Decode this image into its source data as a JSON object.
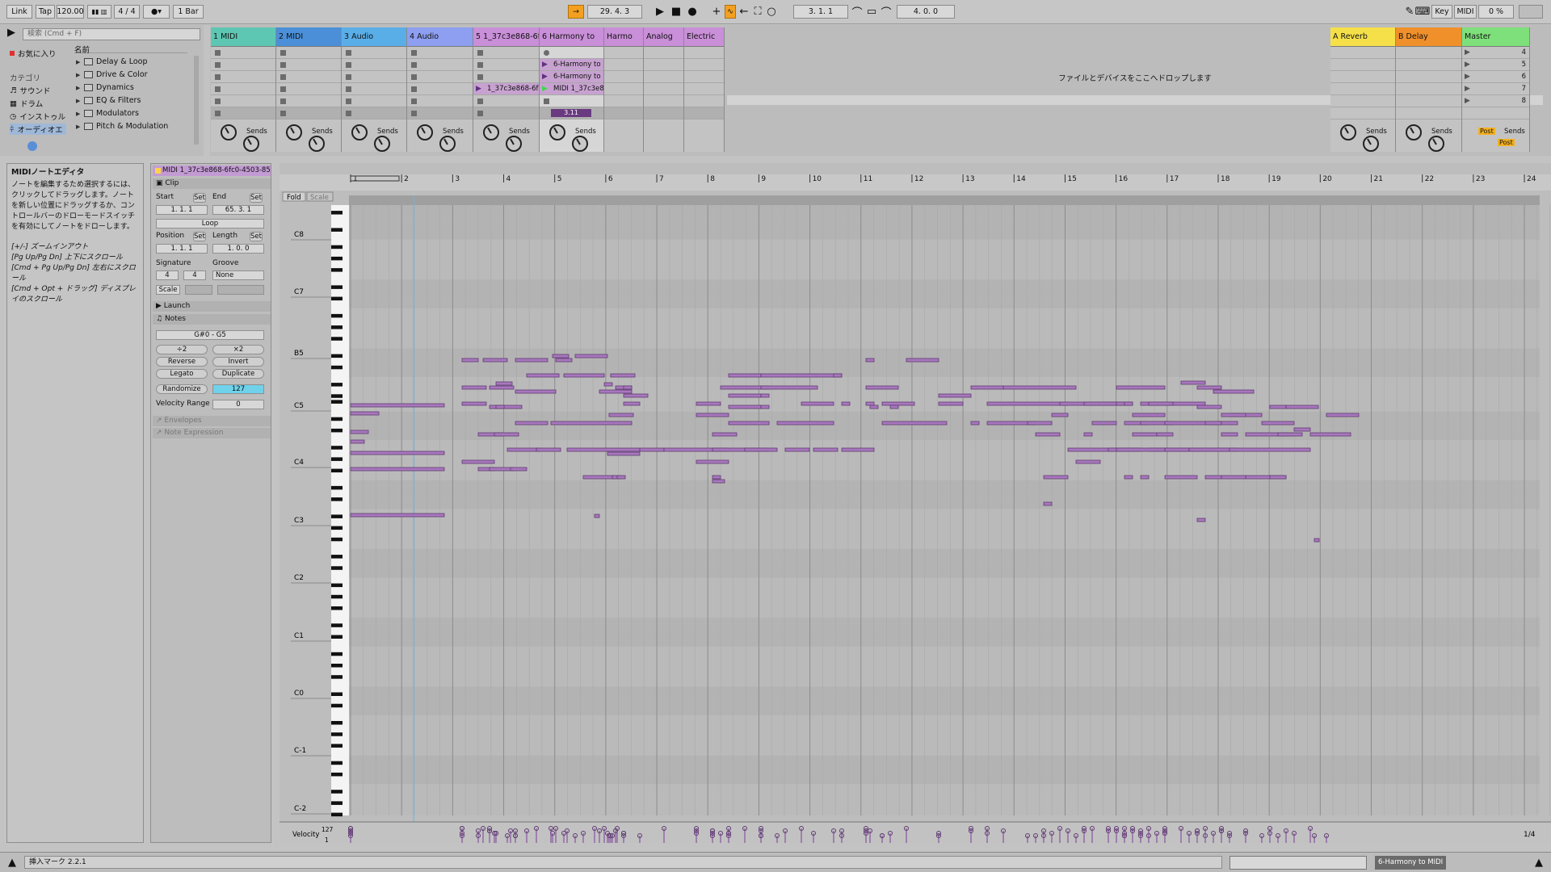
{
  "transport": {
    "link": "Link",
    "tap": "Tap",
    "tempo": "120.00",
    "signature": "4 / 4",
    "quantize": "1 Bar",
    "position": "29.   4.   3",
    "loop_start": "3.   1.   1",
    "loop_length": "4.   0.   0",
    "key": "Key",
    "midi": "MIDI",
    "cpu": "0 %"
  },
  "browser": {
    "search_placeholder": "検索 (Cmd + F)",
    "favorites": "お気に入り",
    "category_title": "カテゴリ",
    "categories": [
      "サウンド",
      "ドラム",
      "インストゥル",
      "オーディオエ"
    ],
    "name_header": "名前",
    "folders": [
      "Delay & Loop",
      "Drive & Color",
      "Dynamics",
      "EQ & Filters",
      "Modulators",
      "Pitch & Modulation"
    ]
  },
  "tracks": [
    {
      "name": "1 MIDI",
      "color": "#5ec7b3"
    },
    {
      "name": "2 MIDI",
      "color": "#4a8fd8"
    },
    {
      "name": "3 Audio",
      "color": "#5aaee8"
    },
    {
      "name": "4 Audio",
      "color": "#8e9ef0"
    },
    {
      "name": "5 1_37c3e868-6fc",
      "color": "#c98fd8"
    },
    {
      "name": "6 Harmony to",
      "color": "#c98fd8"
    },
    {
      "name": "Harmo",
      "color": "#c98fd8"
    },
    {
      "name": "Analog",
      "color": "#c98fd8"
    },
    {
      "name": "Electric",
      "color": "#c98fd8"
    }
  ],
  "clips": {
    "track5_clip": "1_37c3e868-6f",
    "track6_clip1": "6-Harmony to M",
    "track6_clip2": "6-Harmony to M",
    "track6_clip3": "MIDI 1_37c3e8",
    "track6_playhead": "3.11"
  },
  "returns": [
    {
      "name": "A Reverb",
      "color": "#f5e04a"
    },
    {
      "name": "B Delay",
      "color": "#f0902a"
    },
    {
      "name": "Master",
      "color": "#7ee07a"
    }
  ],
  "scene_numbers": [
    "4",
    "5",
    "6",
    "7",
    "8"
  ],
  "drop_hint": "ファイルとデバイスをここへドロップします",
  "sends_label": "Sends",
  "post_label": "Post",
  "info_view": {
    "title": "MIDIノートエディタ",
    "body": "ノートを編集するため選択するには、クリックしてドラッグします。ノートを新しい位置にドラッグするか、コントロールバーのドローモードスイッチを有効にしてノートをドローします。",
    "shortcut1": "[+/-] ズームインアウト",
    "shortcut2": "[Pg Up/Pg Dn] 上下にスクロール",
    "shortcut3": "[Cmd + Pg Up/Pg Dn] 左右にスクロール",
    "shortcut4": "[Cmd + Opt + ドラッグ] ディスプレイのスクロール"
  },
  "clip_view": {
    "title": "MIDI 1_37c3e868-6fc0-4503-85",
    "clip_label": "Clip",
    "start_label": "Start",
    "end_label": "End",
    "set": "Set",
    "start_value": "1.   1.   1",
    "end_value": "65.   3.   1",
    "loop": "Loop",
    "position_label": "Position",
    "length_label": "Length",
    "position_value": "1.   1.   1",
    "length_value": "1.   0.   0",
    "signature_label": "Signature",
    "groove_label": "Groove",
    "sig_num": "4",
    "sig_den": "4",
    "groove_value": "None",
    "scale": "Scale",
    "launch": "Launch",
    "notes": "Notes",
    "note_range": "G#0 - G5",
    "x2a": "÷2",
    "x2b": "×2",
    "reverse": "Reverse",
    "invert": "Invert",
    "legato": "Legato",
    "duplicate": "Duplicate",
    "randomize": "Randomize",
    "randomize_value": "127",
    "velocity_range": "Velocity Range",
    "velocity_range_value": "0",
    "envelopes": "Envelopes",
    "note_expression": "Note Expression"
  },
  "editor": {
    "fold": "Fold",
    "scale": "Scale",
    "bars": [
      "1",
      "2",
      "3",
      "4",
      "5",
      "6",
      "7",
      "8",
      "9",
      "10",
      "11",
      "12",
      "13",
      "14",
      "15",
      "16",
      "17",
      "18",
      "19",
      "20",
      "21",
      "22",
      "23",
      "24"
    ],
    "octaves": [
      "C8",
      "C7",
      "B5",
      "C5",
      "C4",
      "C3",
      "C2",
      "C1",
      "C0",
      "C-1",
      "C-2"
    ],
    "velocity_label": "Velocity",
    "velocity_max": "127",
    "velocity_min": "1",
    "zoom_label": "1/4"
  },
  "status": {
    "text": "挿入マーク 2.2.1",
    "track_label": "6-Harmony to MIDI"
  },
  "colors": {
    "note": "#a877bd",
    "note_border": "#5e3b70",
    "clip_purple": "#c7a2d0"
  }
}
